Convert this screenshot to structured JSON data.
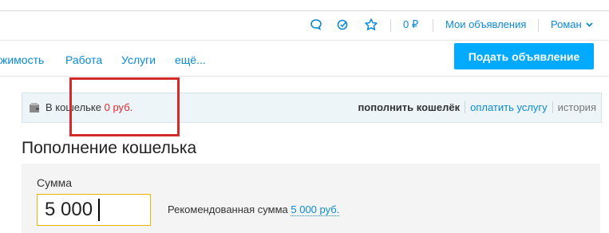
{
  "header": {
    "balance": "0 ₽",
    "my_ads": "Мои объявления",
    "user": "Роман",
    "icons": [
      "chat-icon",
      "favorites-check-icon",
      "star-icon",
      "chevron-down-icon"
    ]
  },
  "nav": {
    "items": [
      "жимость",
      "Работа",
      "Услуги",
      "ещё..."
    ],
    "post_button": "Подать объявление"
  },
  "wallet": {
    "label": "В кошельке",
    "amount": "0 руб.",
    "links": [
      "пополнить кошелёк",
      "оплатить услугу",
      "история"
    ]
  },
  "page": {
    "title": "Пополнение кошелька",
    "amount_label": "Сумма",
    "amount_value": "5 000",
    "recommended_label": "Рекомендованная сумма",
    "recommended_value": "5 000 руб."
  },
  "colors": {
    "accent": "#0a8ad6",
    "button": "#00aaff",
    "highlight": "#d42a2a",
    "input_border": "#f0b400"
  }
}
